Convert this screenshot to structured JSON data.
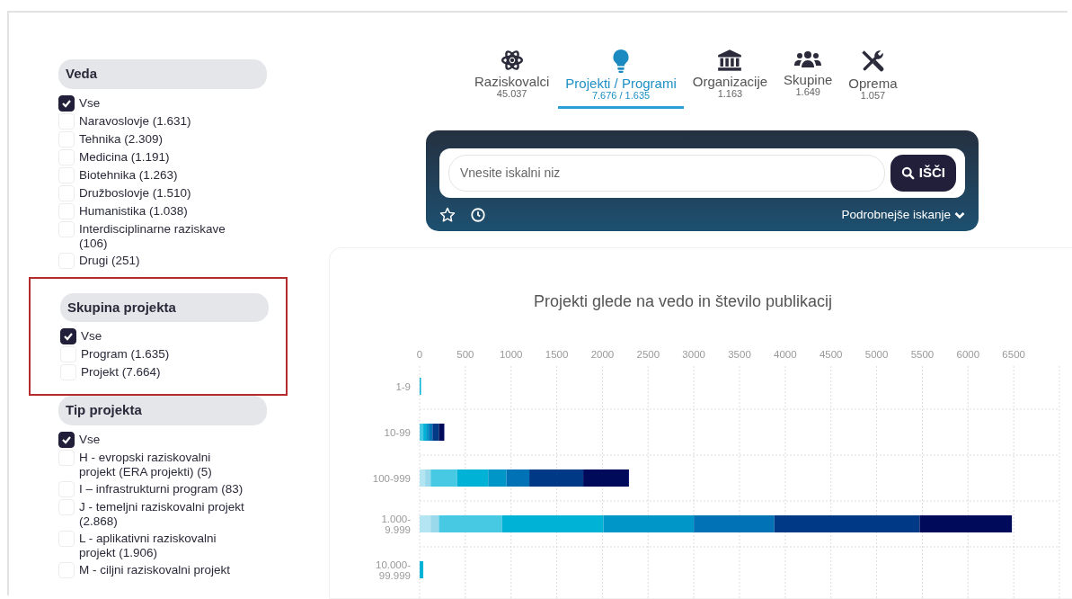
{
  "sidebar": {
    "groups": [
      {
        "title": "Veda",
        "highlighted": false,
        "items": [
          {
            "label": "Vse",
            "checked": true
          },
          {
            "label": "Naravoslovje (1.631)",
            "checked": false
          },
          {
            "label": "Tehnika (2.309)",
            "checked": false
          },
          {
            "label": "Medicina (1.191)",
            "checked": false
          },
          {
            "label": "Biotehnika (1.263)",
            "checked": false
          },
          {
            "label": "Družboslovje (1.510)",
            "checked": false
          },
          {
            "label": "Humanistika (1.038)",
            "checked": false
          },
          {
            "label": "Interdisciplinarne raziskave (106)",
            "checked": false
          },
          {
            "label": "Drugi (251)",
            "checked": false
          }
        ]
      },
      {
        "title": "Skupina projekta",
        "highlighted": true,
        "items": [
          {
            "label": "Vse",
            "checked": true
          },
          {
            "label": "Program (1.635)",
            "checked": false
          },
          {
            "label": "Projekt (7.664)",
            "checked": false
          }
        ]
      },
      {
        "title": "Tip projekta",
        "highlighted": false,
        "items": [
          {
            "label": "Vse",
            "checked": true
          },
          {
            "label": "H - evropski raziskovalni projekt (ERA projekti) (5)",
            "checked": false
          },
          {
            "label": "I – infrastrukturni program (83)",
            "checked": false
          },
          {
            "label": "J - temeljni raziskovalni projekt (2.868)",
            "checked": false
          },
          {
            "label": "L - aplikativni raziskovalni projekt (1.906)",
            "checked": false
          },
          {
            "label": "M - ciljni raziskovalni projekt",
            "checked": false
          }
        ]
      }
    ]
  },
  "tabs": [
    {
      "kind": "atom",
      "label": "Raziskovalci",
      "count": "45.037",
      "selected": false
    },
    {
      "kind": "bulb",
      "label": "Projekti / Programi",
      "count": "7.676 / 1.635",
      "selected": true
    },
    {
      "kind": "bank",
      "label": "Organizacije",
      "count": "1.163",
      "selected": false
    },
    {
      "kind": "people",
      "label": "Skupine",
      "count": "1.649",
      "selected": false
    },
    {
      "kind": "tools",
      "label": "Oprema",
      "count": "1.057",
      "selected": false
    }
  ],
  "search": {
    "placeholder": "Vnesite iskalni niz",
    "button": "IŠČI",
    "advanced": "Podrobnejše iskanje"
  },
  "chart": {
    "chart_data": {
      "type": "bar",
      "orientation": "horizontal",
      "stacked": true,
      "grid": true,
      "title": "Projekti glede na vedo in število publikacij",
      "categories": [
        "1-9",
        "10-99",
        "100-999",
        "1.000-\n9.999",
        "10.000-\n99.999"
      ],
      "xlim": [
        0,
        7000
      ],
      "xticks": [
        0,
        500,
        1000,
        1500,
        2000,
        2500,
        3000,
        3500,
        4000,
        4500,
        5000,
        5500,
        6000,
        6500
      ],
      "series": [
        {
          "color": "#b3e5f2",
          "values": [
            0,
            0,
            60,
            120,
            0
          ]
        },
        {
          "color": "#9ad9ec",
          "values": [
            0,
            0,
            60,
            90,
            0
          ]
        },
        {
          "color": "#48c9e3",
          "values": [
            0,
            40,
            290,
            690,
            0
          ]
        },
        {
          "color": "#00b2d6",
          "values": [
            10,
            30,
            340,
            1110,
            40
          ]
        },
        {
          "color": "#0096c8",
          "values": [
            0,
            30,
            200,
            990,
            0
          ]
        },
        {
          "color": "#0072b5",
          "values": [
            0,
            40,
            250,
            880,
            0
          ]
        },
        {
          "color": "#003a87",
          "values": [
            0,
            70,
            590,
            1590,
            0
          ]
        },
        {
          "color": "#000a5a",
          "values": [
            0,
            60,
            500,
            1010,
            0
          ]
        }
      ]
    }
  }
}
